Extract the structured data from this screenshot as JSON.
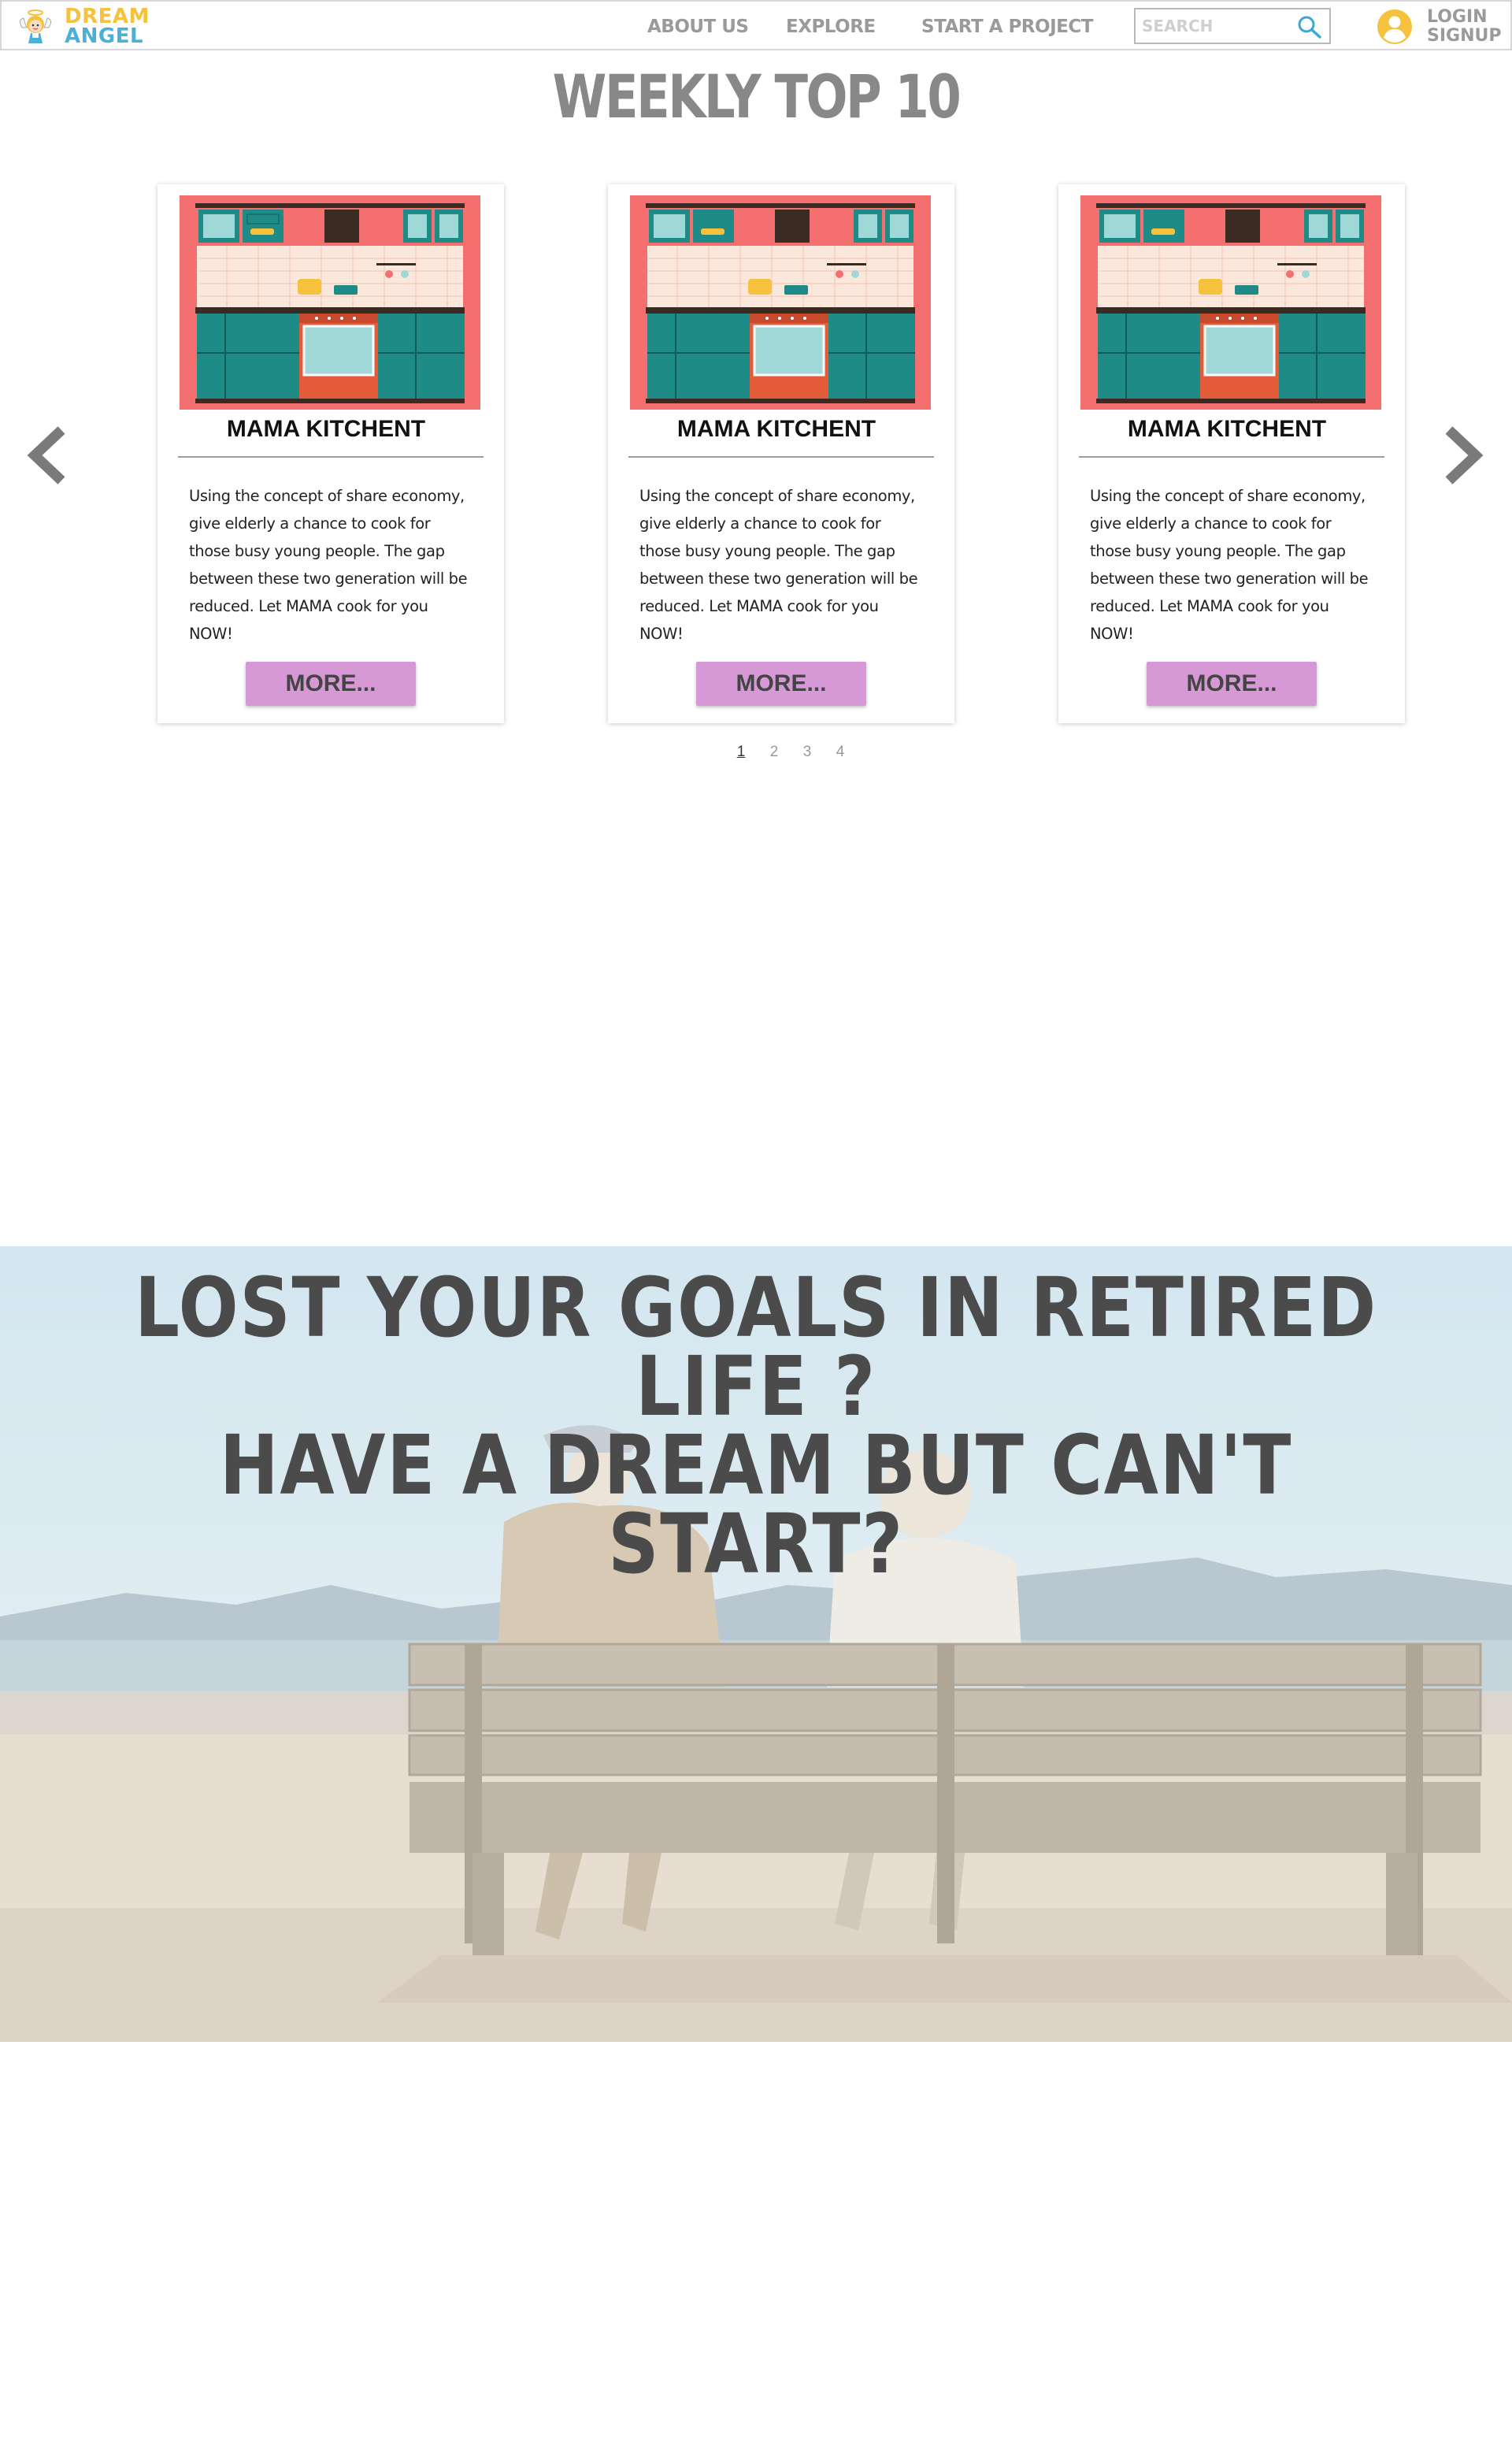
{
  "brand": {
    "line1": "DREAM",
    "line2": "ANGEL",
    "colors": {
      "yellow": "#f6c23e",
      "blue": "#4ab0d9"
    }
  },
  "nav": {
    "about": "ABOUT US",
    "explore": "EXPLORE",
    "start": "START A PROJECT"
  },
  "search": {
    "placeholder": "SEARCH",
    "icon": "search-icon"
  },
  "auth": {
    "login": "LOGIN",
    "signup": "SIGNUP",
    "icon": "user-circle-icon",
    "icon_color": "#f6c23e"
  },
  "weekly": {
    "title": "WEEKLY TOP 10",
    "cards": [
      {
        "title": "MAMA KITCHENT",
        "description": "Using the concept of share economy, give elderly  a chance to cook for those busy young people. The gap between these two generation will be reduced. Let MAMA cook for you NOW!",
        "button": "MORE..."
      },
      {
        "title": "MAMA KITCHENT",
        "description": "Using the concept of share economy, give elderly  a chance to cook for those busy young people. The gap between these two generation will be reduced. Let MAMA cook for you NOW!",
        "button": "MORE..."
      },
      {
        "title": "MAMA KITCHENT",
        "description": "Using the concept of share economy, give elderly  a chance to cook for those busy young people. The gap between these two generation will be reduced. Let MAMA cook for you NOW!",
        "button": "MORE..."
      }
    ],
    "pages": [
      "1",
      "2",
      "3",
      "4"
    ],
    "current_page": "1",
    "button_color": "#d799d6"
  },
  "hero": {
    "line1": "LOST YOUR GOALS IN RETIRED LIFE ?",
    "line2": "HAVE A DREAM BUT CAN'T START?"
  }
}
